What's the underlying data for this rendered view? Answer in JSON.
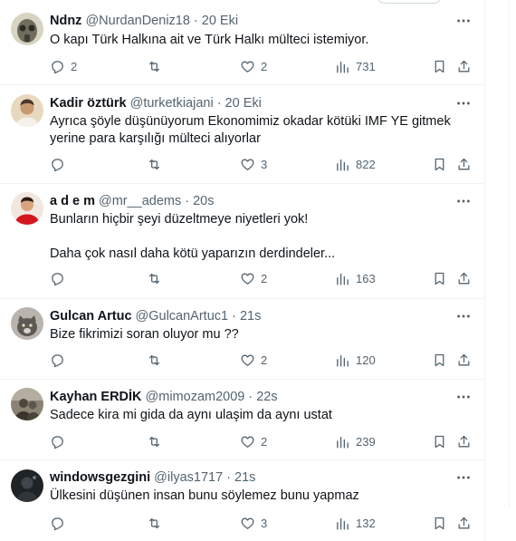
{
  "tweets": [
    {
      "name": "Ndnz",
      "handle": "@NurdanDeniz18",
      "time": "20 Eki",
      "lines": [
        "O kapı Türk Halkına ait ve Türk Halkı mülteci istemiyor."
      ],
      "replies": "2",
      "retweets": "",
      "likes": "2",
      "views": "731",
      "avatar": "gasmask-avatar"
    },
    {
      "name": "Kadir öztürk",
      "handle": "@turketkiajani",
      "time": "20 Eki",
      "lines": [
        "Ayrıca şöyle düşünüyorum Ekonomimiz okadar kötüki IMF YE gitmek yerine para karşılığı mülteci alıyorlar"
      ],
      "replies": "",
      "retweets": "",
      "likes": "3",
      "views": "822",
      "avatar": "person-avatar"
    },
    {
      "name": "a d e m",
      "handle": "@mr__adems",
      "time": "20s",
      "lines": [
        "Bunların hiçbir şeyi düzeltmeye niyetleri yok!",
        "Daha çok nasıl daha kötü yaparızın derdindeler..."
      ],
      "replies": "",
      "retweets": "",
      "likes": "2",
      "views": "163",
      "avatar": "red-shirt-avatar"
    },
    {
      "name": "Gulcan Artuc",
      "handle": "@GulcanArtuc1",
      "time": "21s",
      "lines": [
        "Bize fikrimizi soran oluyor mu ??"
      ],
      "replies": "",
      "retweets": "",
      "likes": "2",
      "views": "120",
      "avatar": "cat-avatar"
    },
    {
      "name": "Kayhan ERDİK",
      "handle": "@mimozam2009",
      "time": "22s",
      "lines": [
        "Sadece kira mi gida da aynı ulaşim da aynı ustat"
      ],
      "replies": "",
      "retweets": "",
      "likes": "2",
      "views": "239",
      "avatar": "photo-avatar"
    },
    {
      "name": "windowsgezgini",
      "handle": "@ilyas1717",
      "time": "21s",
      "lines": [
        "Ülkesini düşünen insan bunu söylemez bunu yapmaz"
      ],
      "replies": "",
      "retweets": "",
      "likes": "3",
      "views": "132",
      "avatar": "dark-avatar"
    }
  ],
  "colors": {
    "text": "#0f1419",
    "secondary": "#536471",
    "divider": "#eff3f4"
  }
}
